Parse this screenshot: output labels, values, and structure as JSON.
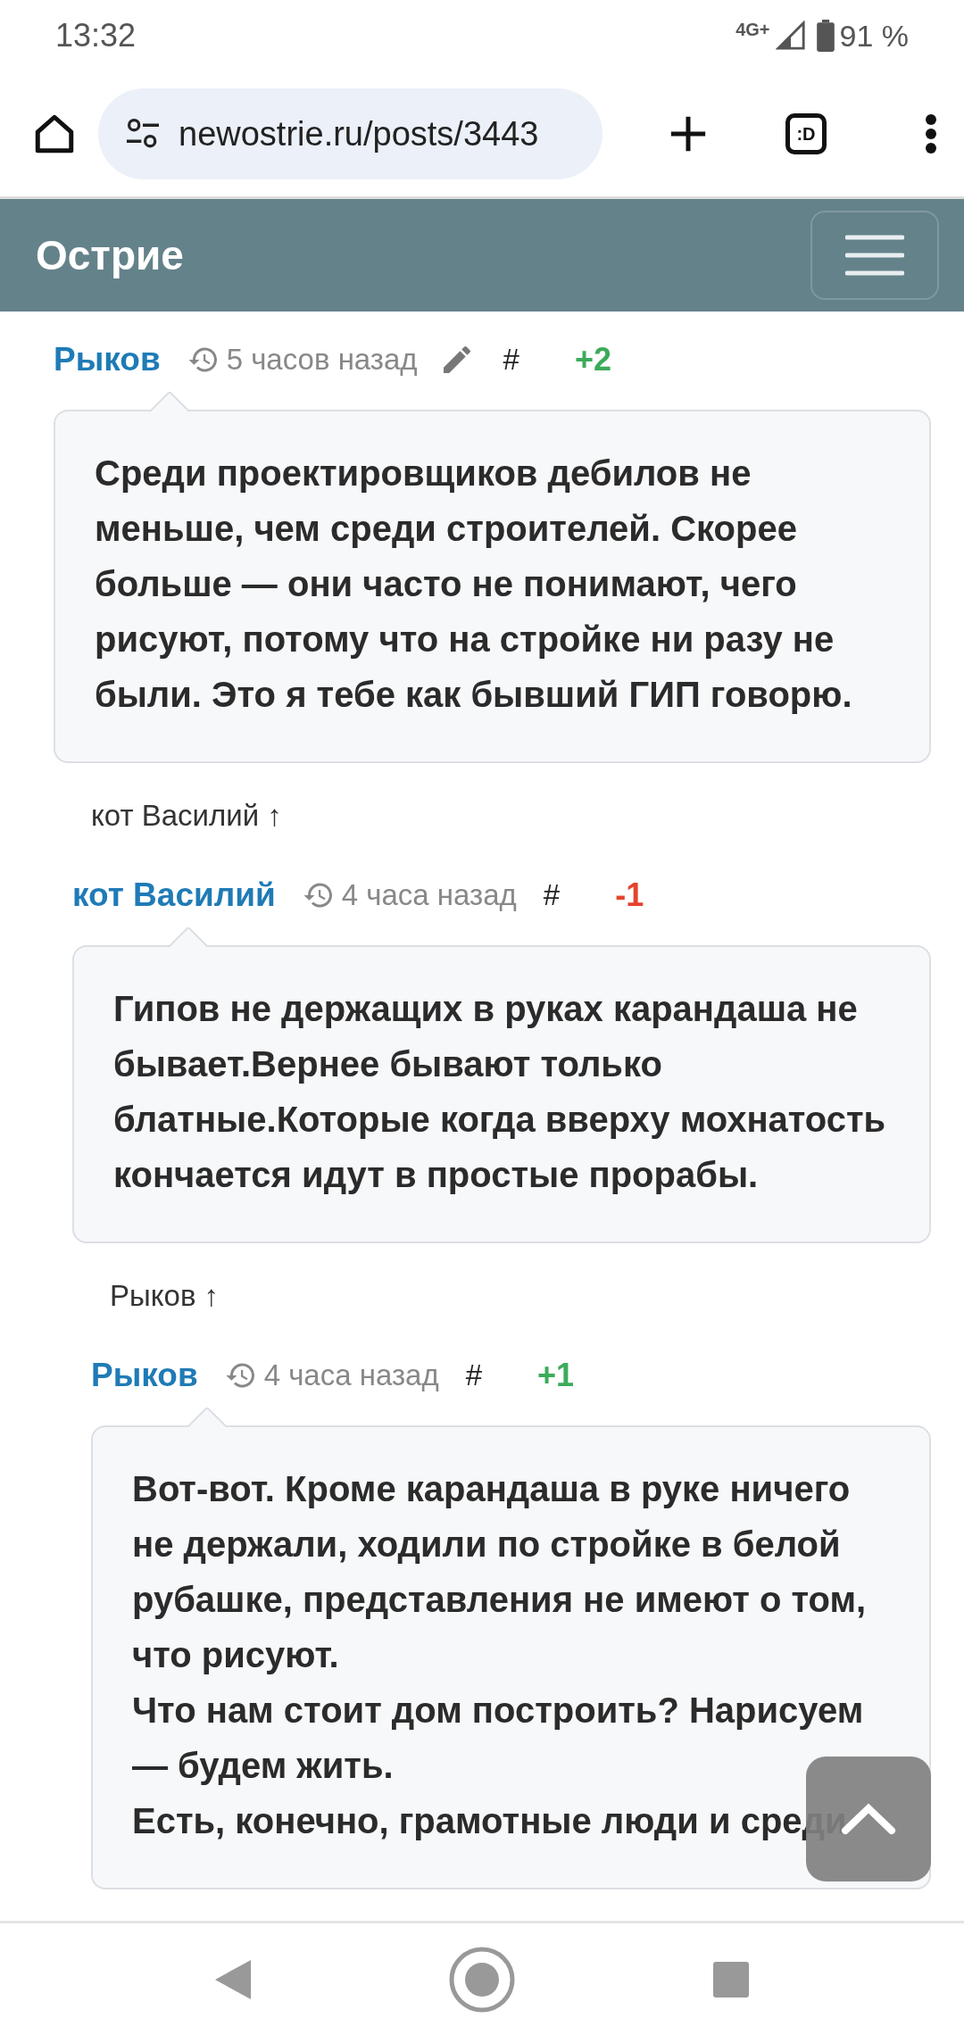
{
  "status_bar": {
    "time": "13:32",
    "network": "4G+",
    "battery": "91 %"
  },
  "browser": {
    "url": "newostrie.ru/posts/3443",
    "tab_switcher": ":D"
  },
  "navbar": {
    "brand": "Острие"
  },
  "comments": [
    {
      "author": "Рыков",
      "time": "5 часов назад",
      "editable": true,
      "anchor": "#",
      "vote": "+2",
      "color": "#3cab5a",
      "paragraphs": [
        "Среди проектировщиков дебилов не меньше, чем среди строителей. Скорее больше — они часто не понимают, чего рисуют, потому что на стройке ни разу не были. Это я тебе как бывший ГИП говорю."
      ],
      "reply_link": "кот Василий ↑",
      "children": [
        {
          "author": "кот Василий",
          "time": "4 часа назад",
          "editable": false,
          "anchor": "#",
          "vote": "-1",
          "color": "#e5432d",
          "paragraphs": [
            "Гипов не держащих в руках карандаша не бывает.Вернее бывают только блатные.Которые когда вверху мохнатость кончается идут в простые прорабы."
          ],
          "reply_link": "Рыков ↑",
          "children": [
            {
              "author": "Рыков",
              "time": "4 часа назад",
              "editable": false,
              "anchor": "#",
              "vote": "+1",
              "color": "#3cab5a",
              "paragraphs": [
                "Вот-вот. Кроме карандаша в руке ничего не держали, ходили по стройке в белой рубашке, представления не имеют о том, что рисуют.",
                "Что нам стоит дом построить? Нарисуем — будем жить.",
                "Есть, конечно, грамотные люди и среди"
              ]
            }
          ]
        }
      ]
    }
  ]
}
